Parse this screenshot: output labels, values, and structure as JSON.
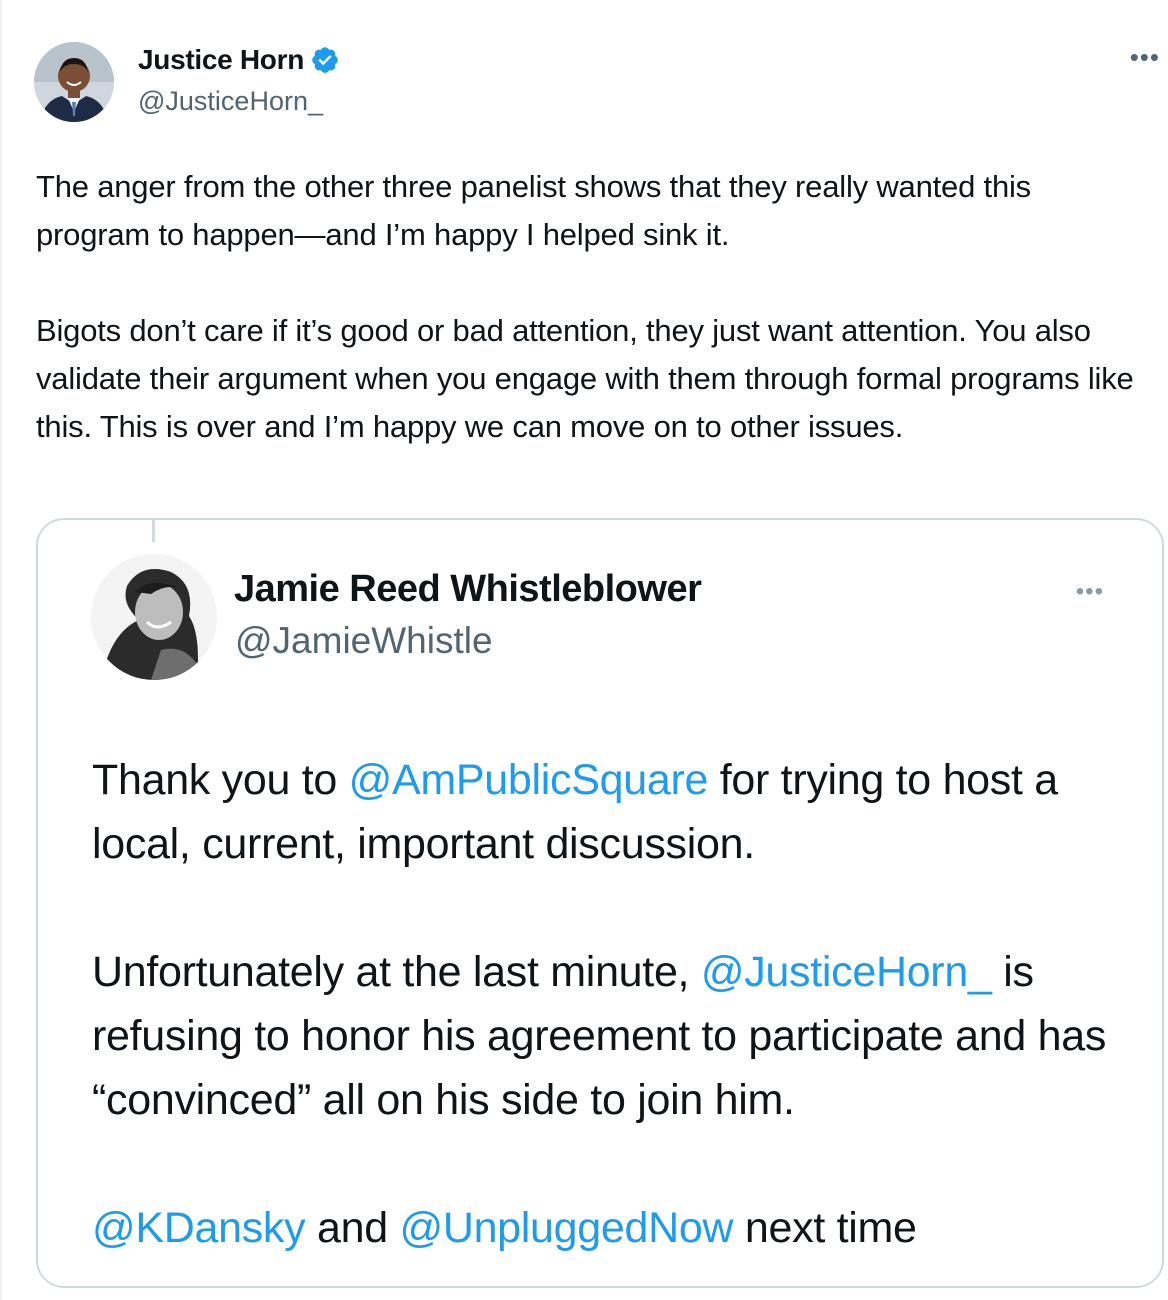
{
  "post": {
    "author_name": "Justice Horn",
    "author_handle": "@JusticeHorn_",
    "more_label": "•••",
    "text": "The anger from the other three panelist shows that they really wanted this program to happen—and I’m happy I helped sink it.\n\nBigots don’t care if it’s good or bad attention, they just want attention. You also validate their argument when you engage with them through formal programs like this. This is over and I’m happy we can move on to other issues."
  },
  "quoted": {
    "author_name": "Jamie Reed Whistleblower",
    "author_handle": "@JamieWhistle",
    "more_label": "•••",
    "p1_a": "Thank you to ",
    "p1_mention": "@AmPublicSquare",
    "p1_b": " for trying to host a local, current, important discussion.",
    "p2_a": "Unfortunately at the last minute, ",
    "p2_mention": "@JusticeHorn_",
    "p2_b": " is refusing to honor his agreement to participate and has “convinced” all on his side to join him.",
    "p3_mention1": "@KDansky",
    "p3_mid": " and ",
    "p3_mention2": "@UnpluggedNow",
    "p3_end": " next time"
  },
  "colors": {
    "accent": "#1d9bf0",
    "text": "#0f1419",
    "muted": "#536471",
    "border": "#cfd9de"
  },
  "icons": {
    "verified": "verified-badge-icon",
    "more": "more-options-icon"
  }
}
